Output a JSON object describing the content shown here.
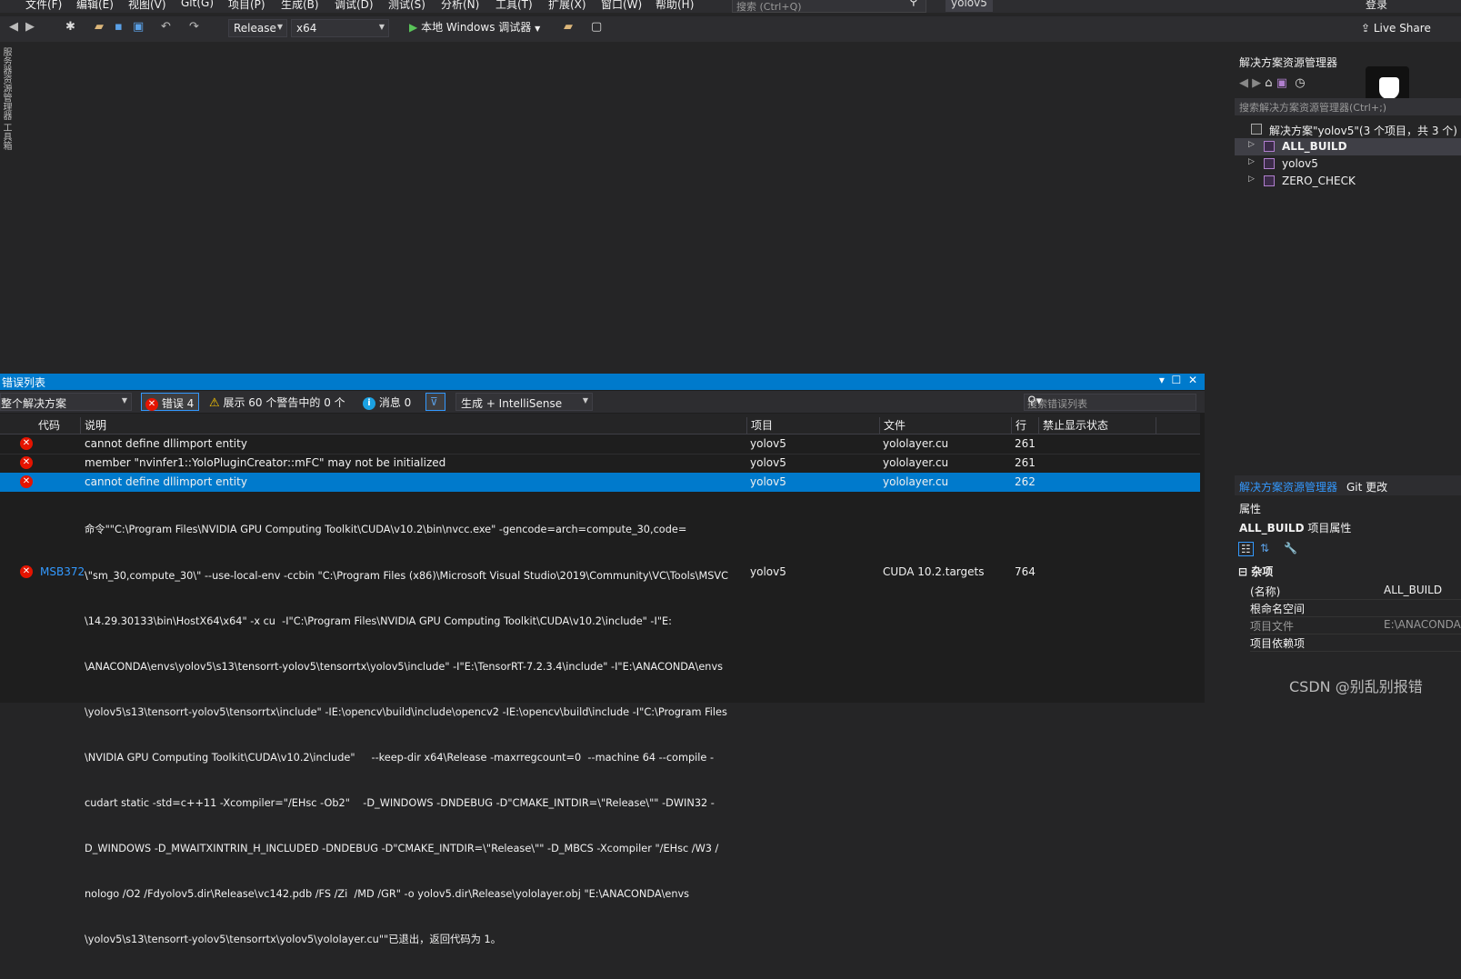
{
  "menu": [
    "文件(F)",
    "编辑(E)",
    "视图(V)",
    "Git(G)",
    "项目(P)",
    "生成(B)",
    "调试(D)",
    "测试(S)",
    "分析(N)",
    "工具(T)",
    "扩展(X)",
    "窗口(W)",
    "帮助(H)"
  ],
  "search_placeholder": "搜索 (Ctrl+Q)",
  "window_title": "yolov5",
  "login": "登录",
  "toolbar": {
    "config": "Release",
    "platform": "x64",
    "run_label": "本地 Windows 调试器",
    "live_share": "Live Share"
  },
  "left_tabs": "服务器资源管理器  工具箱",
  "solution_explorer": {
    "title": "解决方案资源管理器",
    "search_placeholder": "搜索解决方案资源管理器(Ctrl+;)",
    "solution": "解决方案\"yolov5\"(3 个项目，共 3 个)",
    "projects": [
      "ALL_BUILD",
      "yolov5",
      "ZERO_CHECK"
    ],
    "tabs": [
      "解决方案资源管理器",
      "Git 更改"
    ]
  },
  "properties": {
    "title": "属性",
    "object": "ALL_BUILD",
    "object_suffix": "项目属性",
    "category": "杂项",
    "rows": [
      {
        "k": "(名称)",
        "v": "ALL_BUILD"
      },
      {
        "k": "根命名空间",
        "v": ""
      },
      {
        "k": "项目文件",
        "v": "E:\\ANACONDA"
      },
      {
        "k": "项目依赖项",
        "v": ""
      }
    ]
  },
  "error_list": {
    "title": "错误列表",
    "scope": "整个解决方案",
    "errors_label": "错误 4",
    "warnings_label": "展示 60 个警告中的 0 个",
    "messages_label": "消息 0",
    "build_filter": "生成 + IntelliSense",
    "search_placeholder": "搜索错误列表",
    "columns": [
      "代码",
      "说明",
      "项目",
      "文件",
      "行",
      "禁止显示状态"
    ],
    "rows": [
      {
        "code": "",
        "desc": "cannot define dllimport entity",
        "project": "yolov5",
        "file": "yololayer.cu",
        "line": "261"
      },
      {
        "code": "",
        "desc": "member \"nvinfer1::YoloPluginCreator::mFC\" may not be initialized",
        "project": "yolov5",
        "file": "yololayer.cu",
        "line": "261"
      },
      {
        "code": "",
        "desc": "cannot define dllimport entity",
        "project": "yolov5",
        "file": "yololayer.cu",
        "line": "262"
      },
      {
        "code": "MSB372",
        "desc_lines": [
          "命令\"\"C:\\Program Files\\NVIDIA GPU Computing Toolkit\\CUDA\\v10.2\\bin\\nvcc.exe\" -gencode=arch=compute_30,code=",
          "\\\"sm_30,compute_30\\\" --use-local-env -ccbin \"C:\\Program Files (x86)\\Microsoft Visual Studio\\2019\\Community\\VC\\Tools\\MSVC",
          "\\14.29.30133\\bin\\HostX64\\x64\" -x cu  -I\"C:\\Program Files\\NVIDIA GPU Computing Toolkit\\CUDA\\v10.2\\include\" -I\"E:",
          "\\ANACONDA\\envs\\yolov5\\s13\\tensorrt-yolov5\\tensorrtx\\yolov5\\include\" -I\"E:\\TensorRT-7.2.3.4\\include\" -I\"E:\\ANACONDA\\envs",
          "\\yolov5\\s13\\tensorrt-yolov5\\tensorrtx\\include\" -IE:\\opencv\\build\\include\\opencv2 -IE:\\opencv\\build\\include -I\"C:\\Program Files",
          "\\NVIDIA GPU Computing Toolkit\\CUDA\\v10.2\\include\"     --keep-dir x64\\Release -maxrregcount=0  --machine 64 --compile -",
          "cudart static -std=c++11 -Xcompiler=\"/EHsc -Ob2\"    -D_WINDOWS -DNDEBUG -D\"CMAKE_INTDIR=\\\"Release\\\"\" -DWIN32 -",
          "D_WINDOWS -D_MWAITXINTRIN_H_INCLUDED -DNDEBUG -D\"CMAKE_INTDIR=\\\"Release\\\"\" -D_MBCS -Xcompiler \"/EHsc /W3 /",
          "nologo /O2 /Fdyolov5.dir\\Release\\vc142.pdb /FS /Zi  /MD /GR\" -o yolov5.dir\\Release\\yololayer.obj \"E:\\ANACONDA\\envs",
          "\\yolov5\\s13\\tensorrt-yolov5\\tensorrtx\\yolov5\\yololayer.cu\"\"已退出，返回代码为 1。"
        ],
        "project": "yolov5",
        "file": "CUDA 10.2.targets",
        "line": "764"
      }
    ]
  },
  "watermark": "CSDN @别乱别报错"
}
